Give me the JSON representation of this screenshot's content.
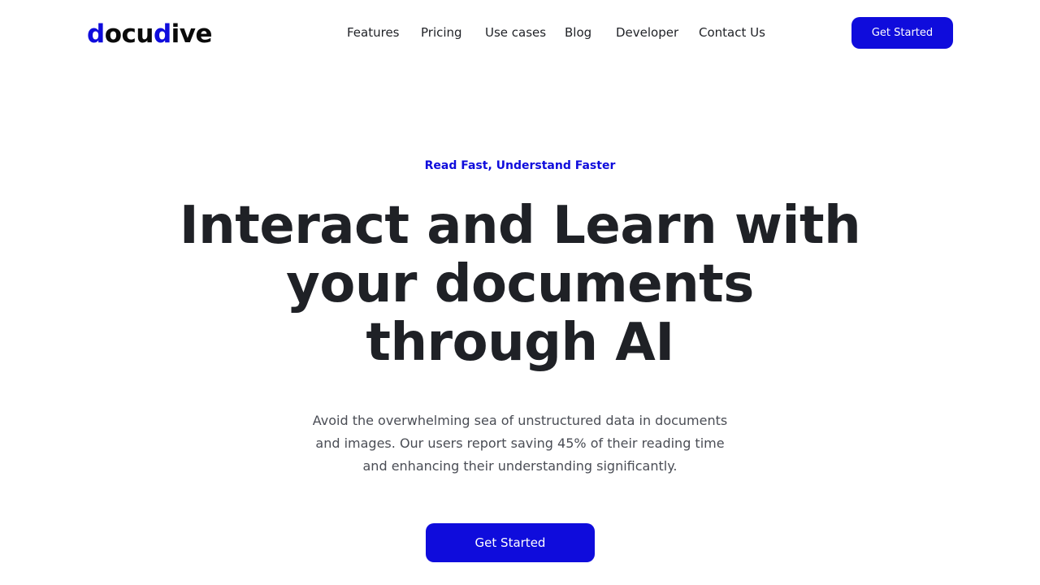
{
  "header": {
    "logo": {
      "part_a": "d",
      "part_b": "ocu",
      "part_c": "d",
      "part_d": "ive"
    },
    "nav": [
      {
        "label": "Features"
      },
      {
        "label": "Pricing"
      },
      {
        "label": "Use cases"
      },
      {
        "label": "Blog"
      },
      {
        "label": "Developer"
      },
      {
        "label": "Contact Us"
      }
    ],
    "cta_label": "Get Started"
  },
  "hero": {
    "eyebrow": "Read Fast, Understand Faster",
    "headline": "Interact and Learn with your documents through AI",
    "subtext": "Avoid the overwhelming sea of unstructured data in documents and images. Our users report saving 45% of their reading time and enhancing their understanding significantly.",
    "cta_label": "Get Started"
  },
  "colors": {
    "accent": "#0f0cdc",
    "text_dark": "#1f2126",
    "text_muted": "#4a4d55",
    "background": "#ffffff"
  }
}
